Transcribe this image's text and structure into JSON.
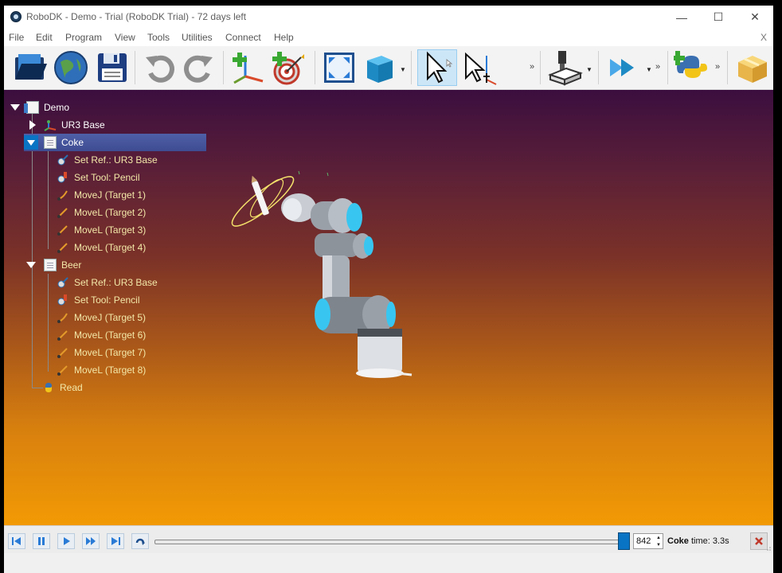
{
  "window": {
    "title": "RoboDK - Demo - Trial (RoboDK Trial) - 72 days left",
    "controls": {
      "minimize": "—",
      "maximize": "☐",
      "close": "✕"
    }
  },
  "menu": {
    "items": [
      "File",
      "Edit",
      "Program",
      "View",
      "Tools",
      "Utilities",
      "Connect",
      "Help"
    ],
    "close": "X"
  },
  "toolbar": {
    "buttons": [
      "open-icon",
      "web-library-icon",
      "save-icon",
      "undo-icon",
      "redo-icon",
      "add-reference-frame-icon",
      "add-target-icon",
      "fit-all-icon",
      "view-cube-icon",
      "select-icon",
      "move-reference-icon",
      "add-tool-icon",
      "run-program-icon",
      "python-program-icon",
      "add-program-icon"
    ]
  },
  "tree": {
    "root": "Demo",
    "items": [
      {
        "label": "UR3 Base",
        "level": 1,
        "icon": "robot-base-icon",
        "expander": "collapsed"
      },
      {
        "label": "Coke",
        "level": 1,
        "icon": "program-icon",
        "expander": "expanded",
        "selected": true
      },
      {
        "label": "Set Ref.: UR3 Base",
        "level": 2,
        "icon": "set-reference-icon"
      },
      {
        "label": "Set Tool: Pencil",
        "level": 2,
        "icon": "set-tool-icon"
      },
      {
        "label": "MoveJ (Target 1)",
        "level": 2,
        "icon": "movej-icon"
      },
      {
        "label": "MoveL (Target 2)",
        "level": 2,
        "icon": "movel-icon"
      },
      {
        "label": "MoveL (Target 3)",
        "level": 2,
        "icon": "movel-icon"
      },
      {
        "label": "MoveL (Target 4)",
        "level": 2,
        "icon": "movel-icon"
      },
      {
        "label": "Beer",
        "level": 1,
        "icon": "program-icon",
        "expander": "expanded"
      },
      {
        "label": "Set Ref.: UR3 Base",
        "level": 2,
        "icon": "set-reference-icon"
      },
      {
        "label": "Set Tool: Pencil",
        "level": 2,
        "icon": "set-tool-icon"
      },
      {
        "label": "MoveJ (Target 5)",
        "level": 2,
        "icon": "movej-icon"
      },
      {
        "label": "MoveL (Target 6)",
        "level": 2,
        "icon": "movel-icon"
      },
      {
        "label": "MoveL (Target 7)",
        "level": 2,
        "icon": "movel-icon"
      },
      {
        "label": "MoveL (Target 8)",
        "level": 2,
        "icon": "movel-icon"
      },
      {
        "label": "Read",
        "level": 1,
        "icon": "python-script-icon"
      }
    ]
  },
  "simulation": {
    "frame": "842",
    "program": "Coke",
    "time_label": "time: 3.3s",
    "progress": 0.98
  },
  "colors": {
    "selection": "#4a5aa3",
    "accent": "#0a74c4",
    "viewport_top": "#3b0e3f",
    "viewport_bottom": "#f29a04"
  }
}
